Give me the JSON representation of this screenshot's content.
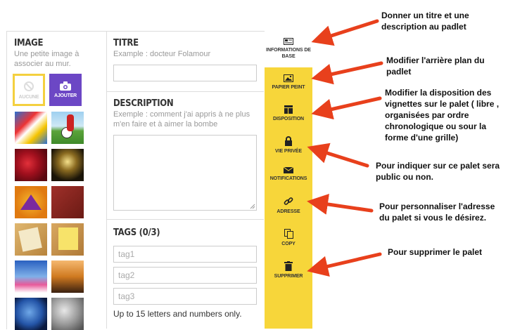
{
  "image_section": {
    "title": "IMAGE",
    "subtitle": "Une petite image à associer au mur.",
    "none_label": "AUCUNE",
    "add_label": "AJOUTER"
  },
  "titre_section": {
    "title": "TITRE",
    "placeholder": "Example : docteur Folamour"
  },
  "description_section": {
    "title": "DESCRIPTION",
    "placeholder": "Exemple : comment j'ai appris à ne plus m'en faire et à aimer la bombe"
  },
  "tags_section": {
    "title": "TAGS (0/3)",
    "tags": [
      "tag1",
      "tag2",
      "tag3"
    ],
    "hint": "Up to 15 letters and numbers only."
  },
  "sidebar": {
    "items": [
      {
        "label": "INFORMATIONS DE BASE",
        "icon": "info-card-icon"
      },
      {
        "label": "PAPIER PEINT",
        "icon": "picture-icon"
      },
      {
        "label": "DISPOSITION",
        "icon": "layout-icon"
      },
      {
        "label": "VIE PRIVÉE",
        "icon": "lock-icon"
      },
      {
        "label": "NOTIFICATIONS",
        "icon": "envelope-icon"
      },
      {
        "label": "ADRESSE",
        "icon": "link-icon"
      },
      {
        "label": "COPY",
        "icon": "copy-icon"
      },
      {
        "label": "SUPPRIMER",
        "icon": "trash-icon"
      }
    ]
  },
  "annotations": [
    "Donner un titre et une description au padlet",
    "Modifier l'arrière plan du padlet",
    "Modifier la disposition des vignettes sur le palet ( libre , organisées par ordre chronologique ou sour la forme d'une grille)",
    "Pour indiquer sur ce palet sera public ou non.",
    "Pour personnaliser l'adresse du palet si vous le désirez.",
    "Pour supprimer le palet"
  ],
  "colors": {
    "sidebar_yellow": "#f7d63a",
    "add_purple": "#6c47c5",
    "arrow_red": "#e8401c"
  }
}
